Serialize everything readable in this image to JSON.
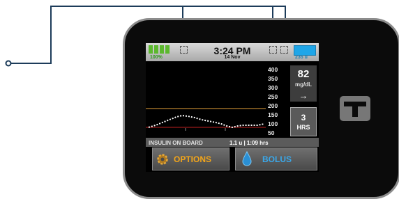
{
  "status": {
    "battery_percent": "100%",
    "time": "3:24 PM",
    "date": "14 Nov",
    "insulin_units": "235 u"
  },
  "graph": {
    "y_ticks": [
      "400",
      "350",
      "300",
      "250",
      "200",
      "150",
      "100",
      "50"
    ]
  },
  "bg": {
    "value": "82",
    "unit": "mg/dL",
    "trend": "→"
  },
  "hours_button": {
    "number": "3",
    "label": "HRS"
  },
  "iob": {
    "label": "INSULIN ON BOARD",
    "value": "1.1 u | 1:09 hrs"
  },
  "buttons": {
    "options": "OPTIONS",
    "bolus": "BOLUS"
  },
  "colors": {
    "options_text": "#f2a51a",
    "bolus_text": "#3aa8ea",
    "battery": "#5cb82e",
    "insulin": "#1fa6e8"
  },
  "icons": [
    "gear-icon",
    "drop-icon",
    "arrow-right-icon",
    "tandem-logo"
  ]
}
